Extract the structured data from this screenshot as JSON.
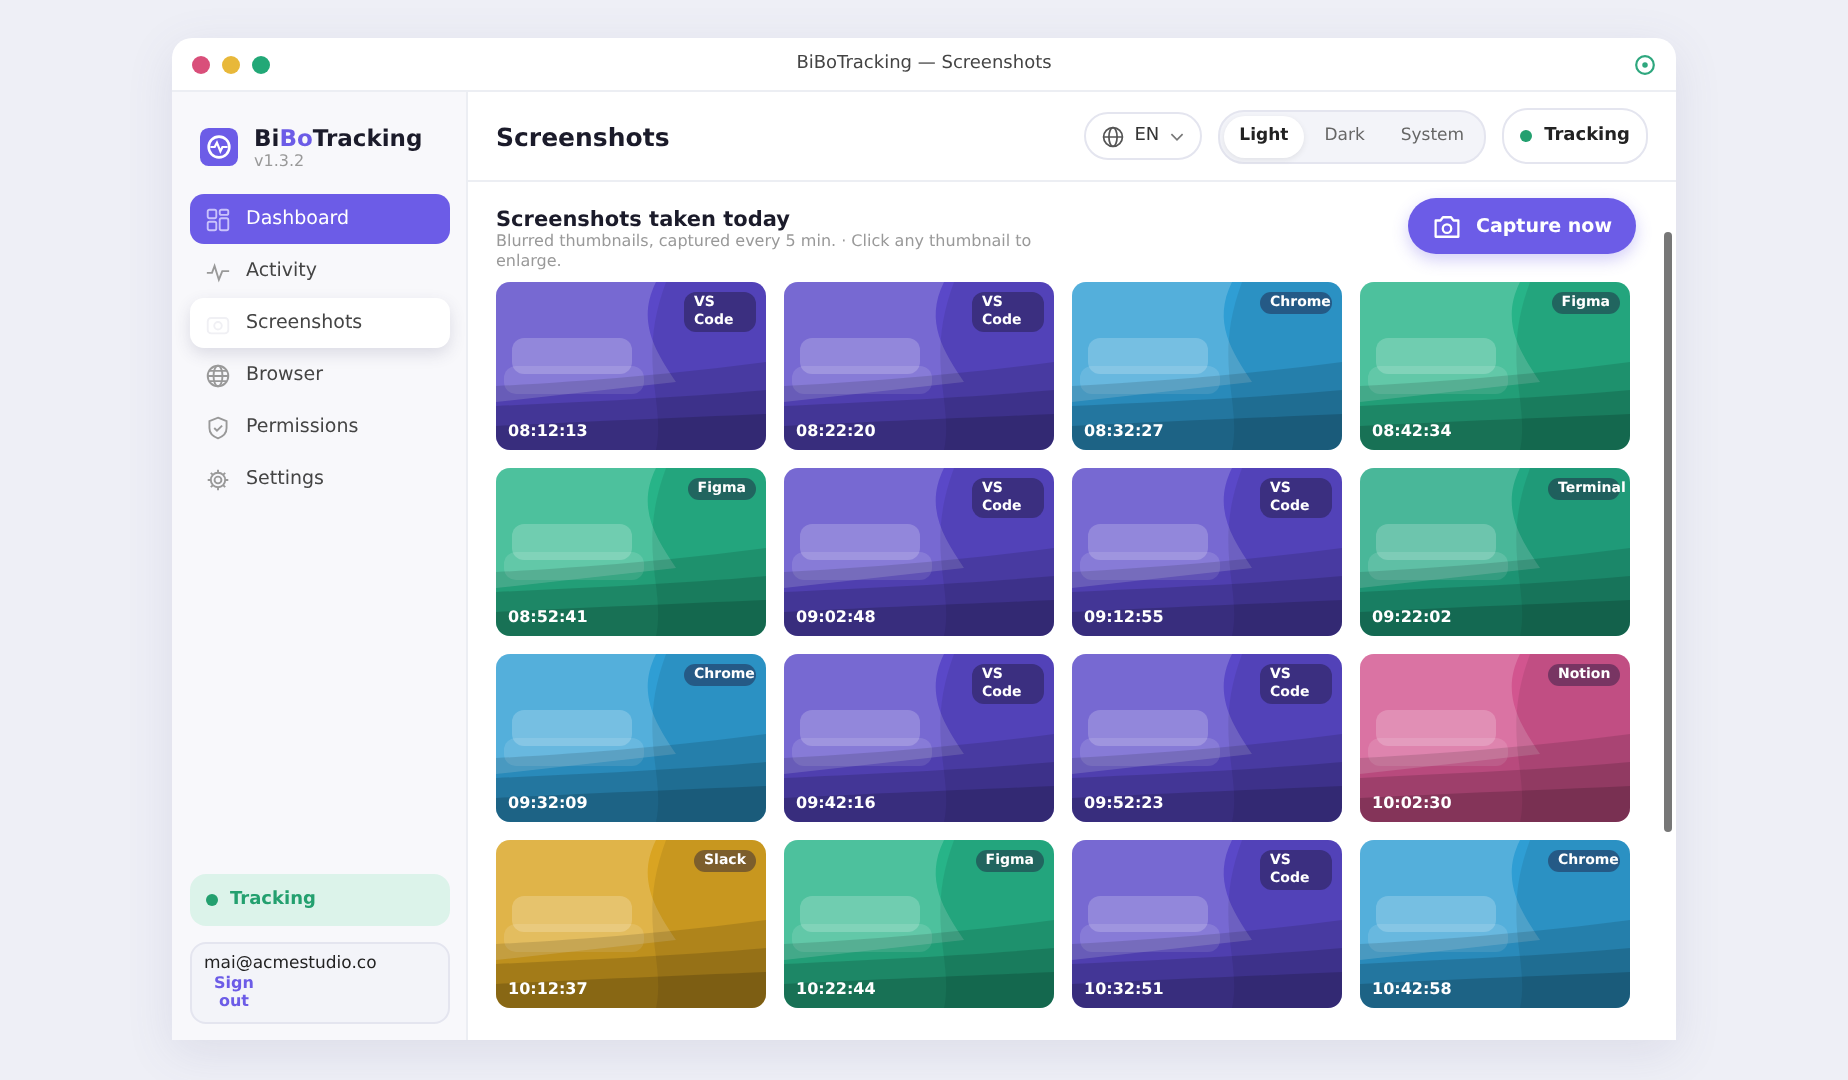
{
  "window": {
    "title": "BiBoTracking — Screenshots"
  },
  "brand": {
    "prefix": "Bi",
    "accent": "Bo",
    "suffix": "Tracking",
    "version": "v1.3.2"
  },
  "sidebar": {
    "items": [
      {
        "label": "Dashboard",
        "kind": "grid",
        "selected": true,
        "raised": false
      },
      {
        "label": "Activity",
        "kind": "pulse",
        "selected": false,
        "raised": false
      },
      {
        "label": "Screenshots",
        "kind": "camera",
        "selected": false,
        "raised": true
      },
      {
        "label": "Browser",
        "kind": "globe",
        "selected": false,
        "raised": false
      },
      {
        "label": "Permissions",
        "kind": "shield",
        "selected": false,
        "raised": false
      },
      {
        "label": "Settings",
        "kind": "gear",
        "selected": false,
        "raised": false
      }
    ],
    "status": {
      "label": "Tracking",
      "on": true
    },
    "account": {
      "email": "mai@acmestudio.co",
      "sign_out": "Sign out"
    }
  },
  "header": {
    "title": "Screenshots",
    "language": "EN",
    "themes": [
      {
        "label": "Light",
        "selected": true
      },
      {
        "label": "Dark",
        "selected": false
      },
      {
        "label": "System",
        "selected": false
      }
    ],
    "tracking": {
      "label": "Tracking",
      "on": true
    }
  },
  "content": {
    "heading": "Screenshots taken today",
    "subtitle": "Blurred thumbnails, captured every 5 min. · Click any thumbnail to enlarge.",
    "capture_button": "Capture now",
    "screenshots": [
      {
        "time": "08:12:13",
        "app": "VS Code",
        "color": "#5a48c8"
      },
      {
        "time": "08:22:20",
        "app": "VS Code",
        "color": "#5a48c8"
      },
      {
        "time": "08:32:27",
        "app": "Chrome",
        "color": "#2f9ed4"
      },
      {
        "time": "08:42:34",
        "app": "Figma",
        "color": "#27b488"
      },
      {
        "time": "08:52:41",
        "app": "Figma",
        "color": "#27b488"
      },
      {
        "time": "09:02:48",
        "app": "VS Code",
        "color": "#5a48c8"
      },
      {
        "time": "09:12:55",
        "app": "VS Code",
        "color": "#5a48c8"
      },
      {
        "time": "09:22:02",
        "app": "Terminal",
        "color": "#22a883"
      },
      {
        "time": "09:32:09",
        "app": "Chrome",
        "color": "#2f9ed4"
      },
      {
        "time": "09:42:16",
        "app": "VS Code",
        "color": "#5a48c8"
      },
      {
        "time": "09:52:23",
        "app": "VS Code",
        "color": "#5a48c8"
      },
      {
        "time": "10:02:30",
        "app": "Notion",
        "color": "#d2558f"
      },
      {
        "time": "10:12:37",
        "app": "Slack",
        "color": "#d9a422"
      },
      {
        "time": "10:22:44",
        "app": "Figma",
        "color": "#27b488"
      },
      {
        "time": "10:32:51",
        "app": "VS Code",
        "color": "#5a48c8"
      },
      {
        "time": "10:42:58",
        "app": "Chrome",
        "color": "#2f9ed4"
      }
    ]
  }
}
